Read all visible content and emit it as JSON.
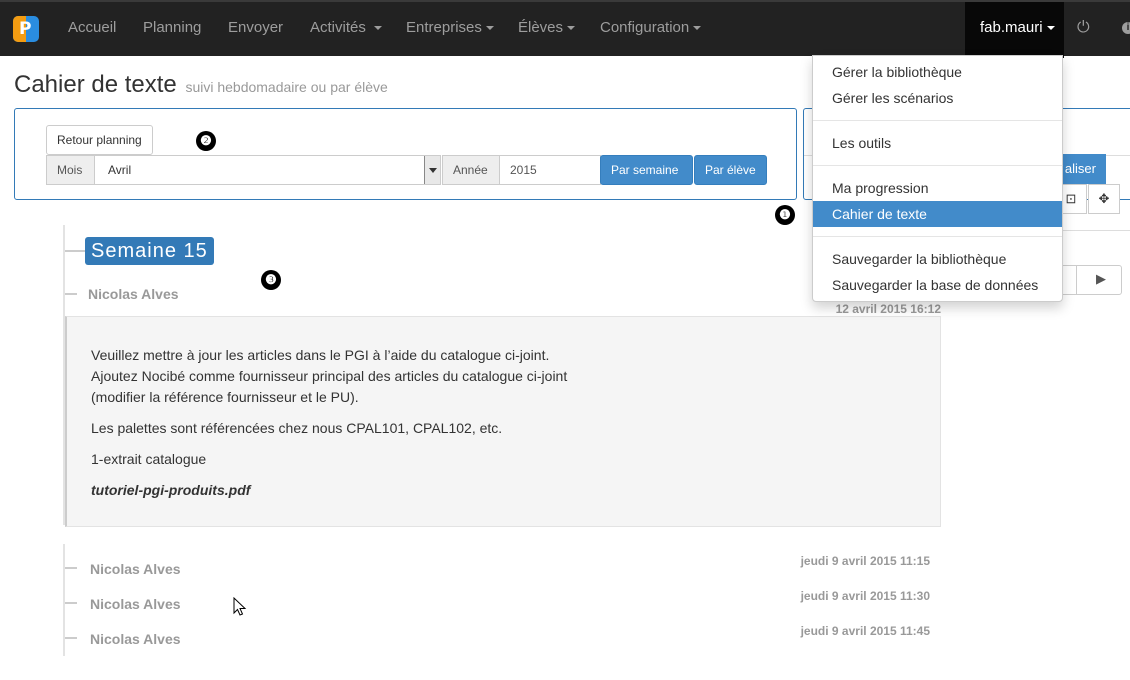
{
  "navbar": {
    "brand_letter": "P",
    "items": [
      {
        "label": "Accueil"
      },
      {
        "label": "Planning"
      },
      {
        "label": "Envoyer"
      },
      {
        "label": "Activités"
      },
      {
        "label": "Entreprises"
      },
      {
        "label": "Élèves"
      },
      {
        "label": "Configuration"
      }
    ],
    "user": "fab.mauri",
    "power_icon": "⏻",
    "info_icon": "i"
  },
  "page": {
    "title": "Cahier de texte",
    "subtitle": "suivi hebdomadaire ou par élève"
  },
  "filters": {
    "retour_label": "Retour planning",
    "mois_label": "Mois",
    "mois_value": "Avril",
    "annee_label": "Année",
    "annee_value": "2015",
    "par_semaine_label": "Par semaine",
    "par_eleve_label": "Par élève"
  },
  "right_panel": {
    "realiser_label": "aliser",
    "icon_collapse": "⊡",
    "icon_move": "✥",
    "icon_play": "▶"
  },
  "markers": [
    "❶",
    "❷",
    "❸"
  ],
  "dropdown": {
    "items": [
      {
        "label": "Gérer la bibliothèque"
      },
      {
        "label": "Gérer les scénarios"
      },
      {
        "label": "Les outils"
      },
      {
        "label": "Ma progression"
      },
      {
        "label": "Cahier de texte"
      },
      {
        "label": "Sauvegarder la bibliothèque"
      },
      {
        "label": "Sauvegarder la base de données"
      }
    ]
  },
  "timeline": {
    "week_label": "Semaine 15",
    "first_entry": {
      "student": "Nicolas Alves",
      "date": "12 avril 2015 16:12",
      "lines": [
        "Veuillez mettre à jour les articles dans le PGI à l’aide du catalogue ci-joint.",
        "Ajoutez Nocibé comme fournisseur principal des articles du catalogue ci-joint",
        "(modifier la référence fournisseur et le PU).",
        "Les palettes sont référencées chez nous CPAL101, CPAL102, etc."
      ],
      "link": "1-extrait catalogue",
      "file": "tutoriel-pgi-produits.pdf"
    },
    "entries": [
      {
        "student": "Nicolas Alves",
        "date": "jeudi 9 avril 2015 11:15"
      },
      {
        "student": "Nicolas Alves",
        "date": "jeudi 9 avril 2015 11:30"
      },
      {
        "student": "Nicolas Alves",
        "date": "jeudi 9 avril 2015 11:45"
      }
    ]
  }
}
